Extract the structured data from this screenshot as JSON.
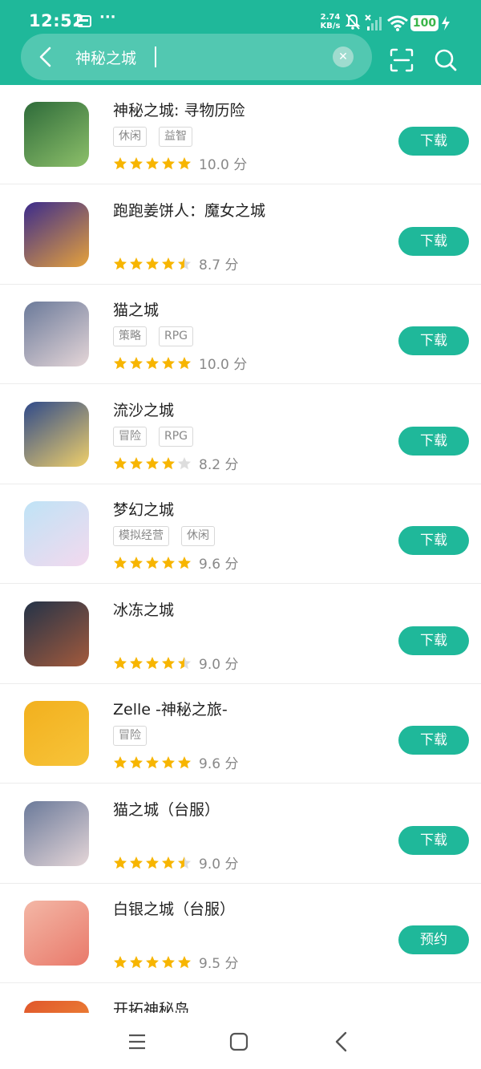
{
  "status_bar": {
    "time": "12:52",
    "dots": "···",
    "net_speed_value": "2.74",
    "net_speed_unit": "KB/s",
    "battery": "100"
  },
  "search": {
    "back_icon": "back-chevron-icon",
    "query": "神秘之城",
    "clear_icon": "clear-icon",
    "scan_icon": "scan-icon",
    "search_icon": "search-icon"
  },
  "results": [
    {
      "name": "神秘之城: 寻物历险",
      "tags": [
        "休闲",
        "益智"
      ],
      "rating": 5,
      "score": "10.0 分",
      "button": "下载",
      "icon_colors": [
        "#2e6b3a",
        "#8dc06a"
      ]
    },
    {
      "name": "跑跑姜饼人：魔女之城",
      "tags": [],
      "rating": 4.5,
      "score": "8.7 分",
      "button": "下载",
      "icon_colors": [
        "#3b2b8c",
        "#e6a23c"
      ]
    },
    {
      "name": "猫之城",
      "tags": [
        "策略",
        "RPG"
      ],
      "rating": 5,
      "score": "10.0 分",
      "button": "下载",
      "icon_colors": [
        "#6b7a9a",
        "#e5d6d8"
      ]
    },
    {
      "name": "流沙之城",
      "tags": [
        "冒险",
        "RPG"
      ],
      "rating": 4,
      "score": "8.2 分",
      "button": "下载",
      "icon_colors": [
        "#2f4a8a",
        "#f0d06a"
      ]
    },
    {
      "name": "梦幻之城",
      "tags": [
        "模拟经营",
        "休闲"
      ],
      "rating": 5,
      "score": "9.6 分",
      "button": "下载",
      "icon_colors": [
        "#bfe3f6",
        "#f3d9ee"
      ]
    },
    {
      "name": "冰冻之城",
      "tags": [],
      "rating": 4.5,
      "score": "9.0 分",
      "button": "下载",
      "icon_colors": [
        "#243348",
        "#a35a3c"
      ]
    },
    {
      "name": "Zelle -神秘之旅-",
      "tags": [
        "冒险"
      ],
      "rating": 5,
      "score": "9.6 分",
      "button": "下载",
      "icon_colors": [
        "#f2b01e",
        "#f7c43a"
      ]
    },
    {
      "name": "猫之城（台服）",
      "tags": [],
      "rating": 4.5,
      "score": "9.0 分",
      "button": "下载",
      "icon_colors": [
        "#6b7a9a",
        "#e5d6d8"
      ]
    },
    {
      "name": "白银之城（台服）",
      "tags": [],
      "rating": 5,
      "score": "9.5 分",
      "button": "预约",
      "icon_colors": [
        "#f3b7a6",
        "#e9796a"
      ]
    },
    {
      "name": "开拓神秘岛",
      "tags": [],
      "rating": 0,
      "score": "",
      "button": "",
      "icon_colors": [
        "#e0562b",
        "#f29a3b"
      ]
    }
  ],
  "colors": {
    "accent": "#1fb89a",
    "star": "#f7b500",
    "star_empty": "#dddddd"
  },
  "nav": {
    "menu_icon": "menu-icon",
    "home_icon": "home-icon",
    "back_icon": "back-icon"
  }
}
